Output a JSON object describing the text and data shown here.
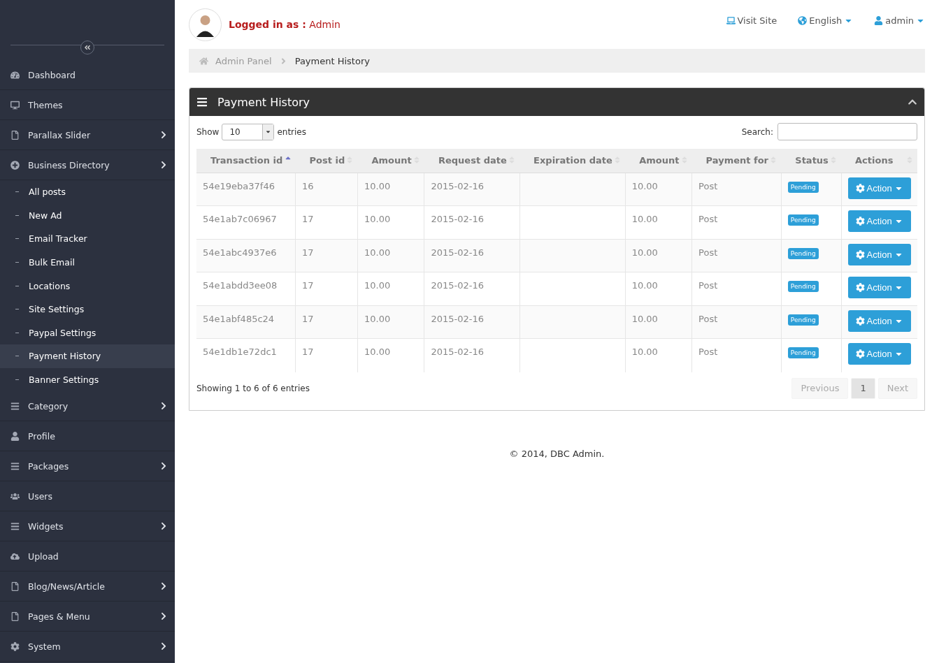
{
  "sidebar": {
    "items": [
      {
        "label": "Dashboard",
        "has_submenu": false
      },
      {
        "label": "Themes",
        "has_submenu": false
      },
      {
        "label": "Parallax Slider",
        "has_submenu": true
      },
      {
        "label": "Business Directory",
        "has_submenu": true,
        "children": [
          {
            "label": "All posts",
            "selected": false
          },
          {
            "label": "New Ad",
            "selected": false
          },
          {
            "label": "Email Tracker",
            "selected": false
          },
          {
            "label": "Bulk Email",
            "selected": false
          },
          {
            "label": "Locations",
            "selected": false
          },
          {
            "label": "Site Settings",
            "selected": false
          },
          {
            "label": "Paypal Settings",
            "selected": false
          },
          {
            "label": "Payment History",
            "selected": true
          },
          {
            "label": "Banner Settings",
            "selected": false
          }
        ]
      },
      {
        "label": "Category",
        "has_submenu": true
      },
      {
        "label": "Profile",
        "has_submenu": false
      },
      {
        "label": "Packages",
        "has_submenu": true
      },
      {
        "label": "Users",
        "has_submenu": false
      },
      {
        "label": "Widgets",
        "has_submenu": true
      },
      {
        "label": "Upload",
        "has_submenu": false
      },
      {
        "label": "Blog/News/Article",
        "has_submenu": true
      },
      {
        "label": "Pages & Menu",
        "has_submenu": true
      },
      {
        "label": "System",
        "has_submenu": true
      }
    ]
  },
  "header": {
    "logged_in_label": "Logged in as :",
    "user": "Admin",
    "links": [
      {
        "label": "Visit Site",
        "dropdown": false
      },
      {
        "label": "English",
        "dropdown": true
      },
      {
        "label": "admin",
        "dropdown": true
      }
    ]
  },
  "breadcrumb": [
    "Admin Panel",
    "Payment History"
  ],
  "panel": {
    "title": "Payment History",
    "length": {
      "show": "Show",
      "value": "10",
      "entries": "entries"
    },
    "search": {
      "label": "Search:"
    },
    "table": {
      "columns": [
        {
          "label": "Transaction id",
          "sorted": true
        },
        {
          "label": "Post id",
          "sorted": false
        },
        {
          "label": "Amount",
          "sorted": false
        },
        {
          "label": "Request date",
          "sorted": false
        },
        {
          "label": "Expiration date",
          "sorted": false
        },
        {
          "label": "Amount",
          "sorted": false
        },
        {
          "label": "Payment for",
          "sorted": false
        },
        {
          "label": "Status",
          "sorted": false
        },
        {
          "label": "Actions",
          "sorted": false
        }
      ],
      "rows": [
        {
          "cells": [
            "54e19eba37f46",
            "16",
            "10.00",
            "2015-02-16",
            "",
            "10.00",
            "Post"
          ],
          "status": "Pending",
          "action": "Action"
        },
        {
          "cells": [
            "54e1ab7c06967",
            "17",
            "10.00",
            "2015-02-16",
            "",
            "10.00",
            "Post"
          ],
          "status": "Pending",
          "action": "Action"
        },
        {
          "cells": [
            "54e1abc4937e6",
            "17",
            "10.00",
            "2015-02-16",
            "",
            "10.00",
            "Post"
          ],
          "status": "Pending",
          "action": "Action"
        },
        {
          "cells": [
            "54e1abdd3ee08",
            "17",
            "10.00",
            "2015-02-16",
            "",
            "10.00",
            "Post"
          ],
          "status": "Pending",
          "action": "Action"
        },
        {
          "cells": [
            "54e1abf485c24",
            "17",
            "10.00",
            "2015-02-16",
            "",
            "10.00",
            "Post"
          ],
          "status": "Pending",
          "action": "Action"
        },
        {
          "cells": [
            "54e1db1e72dc1",
            "17",
            "10.00",
            "2015-02-16",
            "",
            "10.00",
            "Post"
          ],
          "status": "Pending",
          "action": "Action"
        }
      ]
    },
    "info": "Showing 1 to 6 of 6 entries",
    "pagination": [
      {
        "label": "Previous",
        "disabled": true,
        "selected": false
      },
      {
        "label": "1",
        "disabled": false,
        "selected": true
      },
      {
        "label": "Next",
        "disabled": true,
        "selected": false
      }
    ]
  },
  "footer": "© 2014, DBC Admin."
}
